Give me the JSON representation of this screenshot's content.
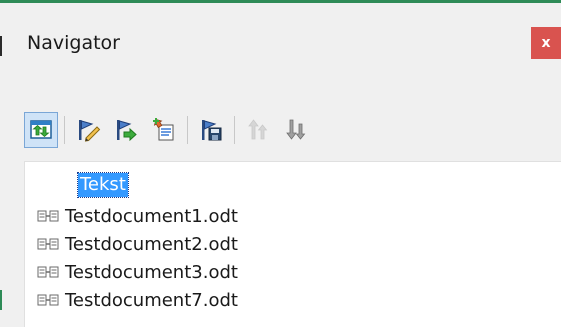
{
  "window": {
    "title": "Navigator",
    "close_label": "x"
  },
  "toolbar": {
    "buttons": [
      {
        "icon": "toggle-view-icon",
        "state": "active"
      },
      {
        "icon": "edit-link-icon"
      },
      {
        "icon": "insert-arrow-icon"
      },
      {
        "icon": "insert-document-icon"
      },
      {
        "icon": "save-contents-icon"
      },
      {
        "icon": "move-up-icon",
        "state": "disabled"
      },
      {
        "icon": "move-down-icon"
      }
    ]
  },
  "tree": {
    "root_label": "Tekst",
    "items": [
      {
        "label": "Testdocument1.odt"
      },
      {
        "label": "Testdocument2.odt"
      },
      {
        "label": "Testdocument3.odt"
      },
      {
        "label": "Testdocument7.odt"
      }
    ]
  },
  "colors": {
    "selection": "#3399ff",
    "close_button": "#d9534f",
    "accent_edge": "#2e8b57"
  }
}
